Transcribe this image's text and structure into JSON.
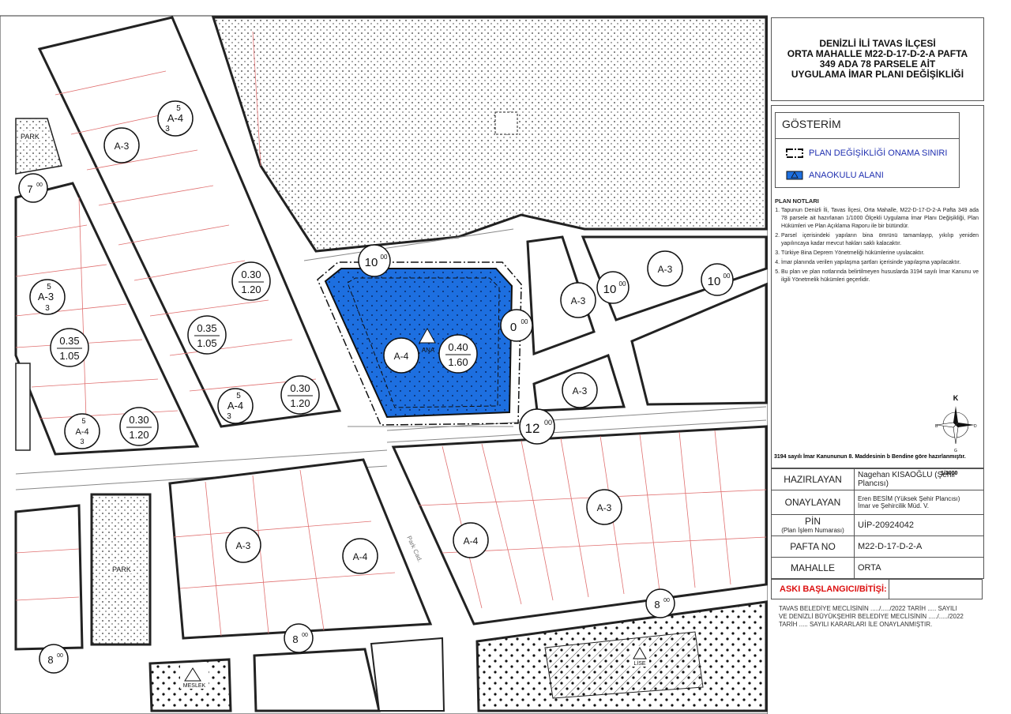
{
  "title": {
    "line1": "DENİZLİ İLİ TAVAS İLÇESİ",
    "line2": "ORTA MAHALLE M22-D-17-D-2-A PAFTA",
    "line3": "349 ADA 78 PARSELE AİT",
    "line4": "UYGULAMA İMAR PLANI DEĞİŞİKLİĞİ"
  },
  "legend": {
    "title": "GÖSTERİM",
    "items": [
      {
        "label": "PLAN DEĞİŞİKLİĞİ ONAMA SINIRI",
        "icon": "boundary-icon"
      },
      {
        "label": "ANAOKULU ALANI",
        "icon": "kindergarten-icon",
        "color": "#1d6fe0"
      }
    ]
  },
  "plan_notes": {
    "title": "PLAN NOTLARI",
    "items": [
      "Tapunun Denizli İli, Tavas İlçesi, Orta Mahalle, M22-D-17-D-2-A Pafta 349 ada 78 parsele ait hazırlanan 1/1000 Ölçekli Uygulama İmar Planı Değişikliği, Plan Hükümleri ve Plan Açıklama Raporu ile bir bütündür.",
      "Parsel içerisindeki yapıların bina ömrünü tamamlayıp, yıkılıp yeniden yapılıncaya kadar mevcut hakları saklı kalacaktır.",
      "Türkiye Bina Deprem Yönetmeliği hükümlerine uyulacaktır.",
      "İmar planında verilen yapılaşma şartları içerisinde yapılaşma yapılacaktır.",
      "Bu plan ve plan notlarında belirtilmeyen hususlarda 3194 sayılı İmar Kanunu ve ilgili Yönetmelik hükümleri geçerlidir."
    ]
  },
  "compass": {
    "north": "K",
    "east": "D",
    "west": "B",
    "south": "G"
  },
  "scale": "1/1000",
  "footer_note": "3194 sayılı İmar Kanununun 8. Maddesinin b Bendine göre hazırlanmıştır.",
  "info": {
    "hazirlayan_label": "HAZIRLAYAN",
    "hazirlayan_value": "Nagehan KISAOĞLU (Şehir Plancısı)",
    "onaylayan_label": "ONAYLAYAN",
    "onaylayan_value1": "Eren BESİM (Yüksek Şehir Plancısı)",
    "onaylayan_value2": "İmar ve Şehircilik Müd. V.",
    "pin_label": "PİN",
    "pin_sublabel": "(Plan İşlem Numarası)",
    "pin_value": "UİP-20924042",
    "pafta_label": "PAFTA NO",
    "pafta_value": "M22-D-17-D-2-A",
    "mahalle_label": "MAHALLE",
    "mahalle_value": "ORTA"
  },
  "aski_label": "ASKI BAŞLANGICI/BİTİŞİ:",
  "approval": {
    "line1": "TAVAS BELEDİYE MECLİSİNİN ...../...../2022 TARİH ..... SAYILI",
    "line2": "VE DENİZLİ BÜYÜKŞEHİR BELEDİYE MECLİSİNİN ...../...../2022",
    "line3": "TARİH ..... SAYILI KARARLARI İLE ONAYLANMIŞTIR."
  },
  "map": {
    "zone_labels": [
      "A-3",
      "A-3",
      "A-3",
      "A-3",
      "A-3",
      "A-3",
      "A-4",
      "A-4",
      "A-4",
      "A-4"
    ],
    "far_values": [
      {
        "top": "0.30",
        "bottom": "1.20"
      },
      {
        "top": "0.35",
        "bottom": "1.05"
      },
      {
        "top": "0.35",
        "bottom": "1.05"
      },
      {
        "top": "0.30",
        "bottom": "1.20"
      },
      {
        "top": "0.30",
        "bottom": "1.20"
      },
      {
        "top": "0.40",
        "bottom": "1.60"
      }
    ],
    "floor_marks": [
      {
        "top": "5",
        "mid": "A-4",
        "bottom": "3"
      },
      {
        "top": "5",
        "mid": "A-3",
        "bottom": "3"
      },
      {
        "top": "5",
        "mid": "A-4",
        "bottom": "3"
      },
      {
        "top": "5",
        "mid": "A-4",
        "bottom": "3"
      }
    ],
    "road_widths": [
      {
        "value": "10",
        "sup": "00"
      },
      {
        "value": "10",
        "sup": "00"
      },
      {
        "value": "10",
        "sup": "00"
      },
      {
        "value": "0",
        "sup": "00"
      },
      {
        "value": "12",
        "sup": "00"
      },
      {
        "value": "7",
        "sup": "00"
      },
      {
        "value": "8",
        "sup": "00"
      },
      {
        "value": "8",
        "sup": "00"
      },
      {
        "value": "8",
        "sup": "00"
      }
    ],
    "park_labels": [
      "PARK",
      "PARK"
    ],
    "school_labels": [
      "ANA",
      "LİSE",
      "MESLEK"
    ],
    "street_label": "Park Cad."
  }
}
